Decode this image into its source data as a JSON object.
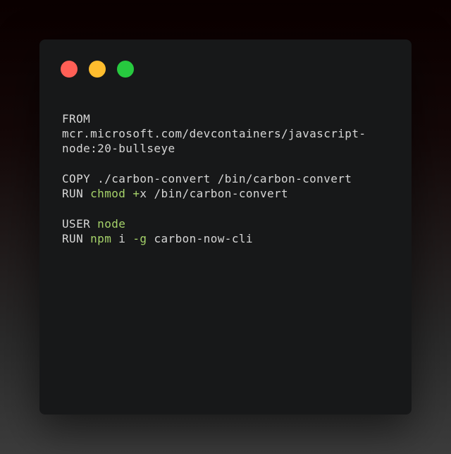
{
  "colors": {
    "close": "#ff5f56",
    "minimize": "#ffbd2e",
    "maximize": "#27c93f",
    "text": "#d7d7d7",
    "highlight": "#a6d36a"
  },
  "code": {
    "line1": "FROM",
    "line2": "mcr.microsoft.com/devcontainers/javascript-",
    "line3": "node:20-bullseye",
    "line4": "COPY ./carbon-convert /bin/carbon-convert",
    "line5_a": "RUN ",
    "line5_b": "chmod",
    "line5_c": " ",
    "line5_d": "+",
    "line5_e": "x /bin/carbon-convert",
    "line6_a": "USER ",
    "line6_b": "node",
    "line7_a": "RUN ",
    "line7_b": "npm",
    "line7_c": " i ",
    "line7_d": "-g",
    "line7_e": " carbon-now-cli"
  }
}
